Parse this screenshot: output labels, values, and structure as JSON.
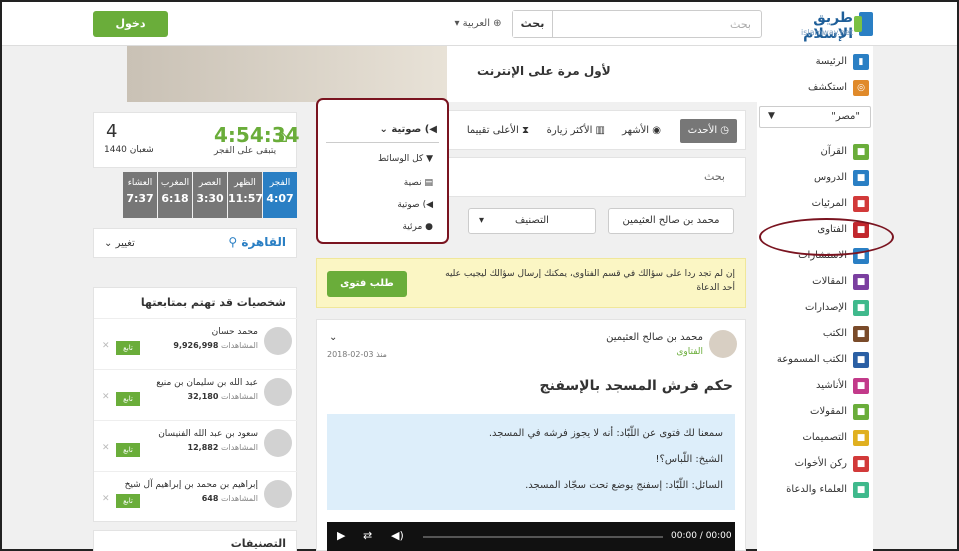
{
  "header": {
    "logo_ar": "طريق الإسلام",
    "logo_en": "islamway.net",
    "search_placeholder": "بحث",
    "search_button": "بحث",
    "lang": "العربية",
    "login": "دخول"
  },
  "banner": {
    "text": "لأول مرة على الإنترنت"
  },
  "sidebar": {
    "items": [
      {
        "label": "الرئيسة",
        "color": "#2a7fc4"
      },
      {
        "label": "استكشف",
        "color": "#e08a2a"
      }
    ],
    "region": "\"مصر\"",
    "items2": [
      {
        "label": "القرآن",
        "color": "#6aad3a"
      },
      {
        "label": "الدروس",
        "color": "#2a7fc4"
      },
      {
        "label": "المرئيات",
        "color": "#d23a3a"
      },
      {
        "label": "الفتاوى",
        "color": "#c2272d"
      },
      {
        "label": "الاستشارات",
        "color": "#2a7fc4"
      },
      {
        "label": "المقالات",
        "color": "#7b3fa0"
      },
      {
        "label": "الإصدارات",
        "color": "#3fb98c"
      },
      {
        "label": "الكتب",
        "color": "#7a4b2a"
      },
      {
        "label": "الكتب المسموعة",
        "color": "#2a5fa4"
      },
      {
        "label": "الأناشيد",
        "color": "#c23a8a"
      },
      {
        "label": "المقولات",
        "color": "#6aad3a"
      },
      {
        "label": "التصميمات",
        "color": "#e0b020"
      },
      {
        "label": "ركن الأخوات",
        "color": "#d23a3a"
      },
      {
        "label": "العلماء والدعاة",
        "color": "#3fb98c"
      }
    ]
  },
  "tabs": {
    "newest": "الأحدث",
    "famous": "الأشهر",
    "most_visited": "الأكثر زيارة",
    "top_rated": "الأعلى تقييما"
  },
  "dropdown": {
    "head": "صوتية",
    "all": "كل الوسائط",
    "text": "نصية",
    "audio": "صوتية",
    "video": "مرئية"
  },
  "search_ph": "بحث",
  "filters": {
    "sheikh": "محمد بن صالح العثيمين",
    "category": "التصنيف"
  },
  "notice": {
    "text": "إن لم تجد ردا على سؤالك في قسم الفتاوى، يمكنك إرسال سؤالك ليجيب عليه أحد الدعاة",
    "button": "طلب فتوى"
  },
  "fatwa": {
    "author": "محمد بن صالح العثيمين",
    "category": "الفتاوى",
    "since": "منذ",
    "date": "03-02-2018",
    "title": "حكم فرش المسجد بالإسفنج",
    "q1": "سمعنا لك فتوى عن اللّبّاد: أنه لا يجوز فرشه في المسجد.",
    "q2": "الشيخ: اللّباس؟!",
    "q3": "السائل: اللّبّاد: إسفنج يوضع تحت سجّاد المسجد.",
    "time": "00:00 / 00:00"
  },
  "prayer": {
    "countdown": "4:54:34",
    "until": "يتبقى على الفجر",
    "hday": "4",
    "hmonth": "شعبان 1440",
    "times": [
      {
        "n": "الفجر",
        "t": "4:07"
      },
      {
        "n": "الظهر",
        "t": "11:57"
      },
      {
        "n": "العصر",
        "t": "3:30"
      },
      {
        "n": "المغرب",
        "t": "6:18"
      },
      {
        "n": "العشاء",
        "t": "7:37"
      }
    ],
    "city": "القاهرة",
    "change": "تغيير"
  },
  "people": {
    "title": "شخصيات قد تهتم بمتابعتها",
    "views_label": "المشاهدات",
    "follow": "تابع",
    "list": [
      {
        "name": "محمد حسان",
        "views": "9,926,998"
      },
      {
        "name": "عبد الله بن سليمان بن منيع",
        "views": "32,180"
      },
      {
        "name": "سعود بن عبد الله الفنيسان",
        "views": "12,882"
      },
      {
        "name": "إبراهيم بن محمد بن إبراهيم آل شيخ",
        "views": "648"
      }
    ]
  },
  "categories": {
    "title": "التصنيفات"
  }
}
